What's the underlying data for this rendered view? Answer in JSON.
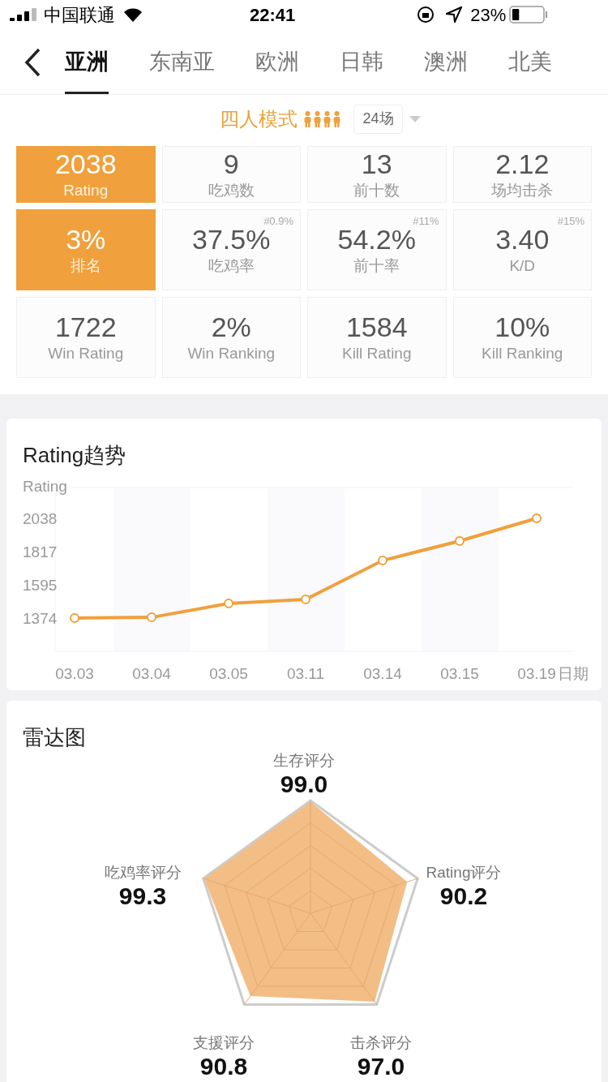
{
  "status_bar": {
    "carrier": "中国联通",
    "time": "22:41",
    "battery": "23%"
  },
  "tabs": [
    {
      "label": "亚洲",
      "selected": true
    },
    {
      "label": "东南亚",
      "selected": false
    },
    {
      "label": "欧洲",
      "selected": false
    },
    {
      "label": "日韩",
      "selected": false
    },
    {
      "label": "澳洲",
      "selected": false
    },
    {
      "label": "北美",
      "selected": false
    }
  ],
  "mode": {
    "label": "四人模式",
    "matches": "24场"
  },
  "stats": [
    {
      "kind": "highlight",
      "value": "2038",
      "label": "Rating"
    },
    {
      "kind": "normal",
      "value": "9",
      "label": "吃鸡数"
    },
    {
      "kind": "normal",
      "value": "13",
      "label": "前十数"
    },
    {
      "kind": "normal",
      "value": "2.12",
      "label": "场均击杀"
    },
    {
      "kind": "highlight",
      "value": "3%",
      "label": "排名"
    },
    {
      "kind": "normal",
      "value": "37.5%",
      "label": "吃鸡率",
      "rank": "#0.9%"
    },
    {
      "kind": "normal",
      "value": "54.2%",
      "label": "前十率",
      "rank": "#11%"
    },
    {
      "kind": "normal",
      "value": "3.40",
      "label": "K/D",
      "rank": "#15%"
    },
    {
      "kind": "normal",
      "value": "1722",
      "label": "Win Rating"
    },
    {
      "kind": "normal",
      "value": "2%",
      "label": "Win Ranking"
    },
    {
      "kind": "normal",
      "value": "1584",
      "label": "Kill Rating"
    },
    {
      "kind": "normal",
      "value": "10%",
      "label": "Kill Ranking"
    }
  ],
  "trend": {
    "title": "Rating趋势",
    "chart_data": {
      "type": "line",
      "ylabel": "Rating",
      "xlabel": "日期",
      "categories": [
        "03.03",
        "03.04",
        "03.05",
        "03.11",
        "03.14",
        "03.15",
        "03.19"
      ],
      "series": [
        {
          "color": "#f0a03c",
          "marker": "circle",
          "values": [
            1374,
            1379,
            1471,
            1498,
            1757,
            1887,
            2038
          ]
        }
      ],
      "ylim": [
        1153,
        2243
      ],
      "yticks": [
        1374,
        1595,
        1817,
        2038
      ]
    }
  },
  "radar": {
    "title": "雷达图",
    "axes": [
      {
        "label": "生存评分",
        "value": "99.0"
      },
      {
        "label": "吃鸡率评分",
        "value": "99.3"
      },
      {
        "label": "Rating评分",
        "value": "90.2"
      },
      {
        "label": "支援评分",
        "value": "90.8"
      },
      {
        "label": "击杀评分",
        "value": "97.0"
      }
    ]
  }
}
